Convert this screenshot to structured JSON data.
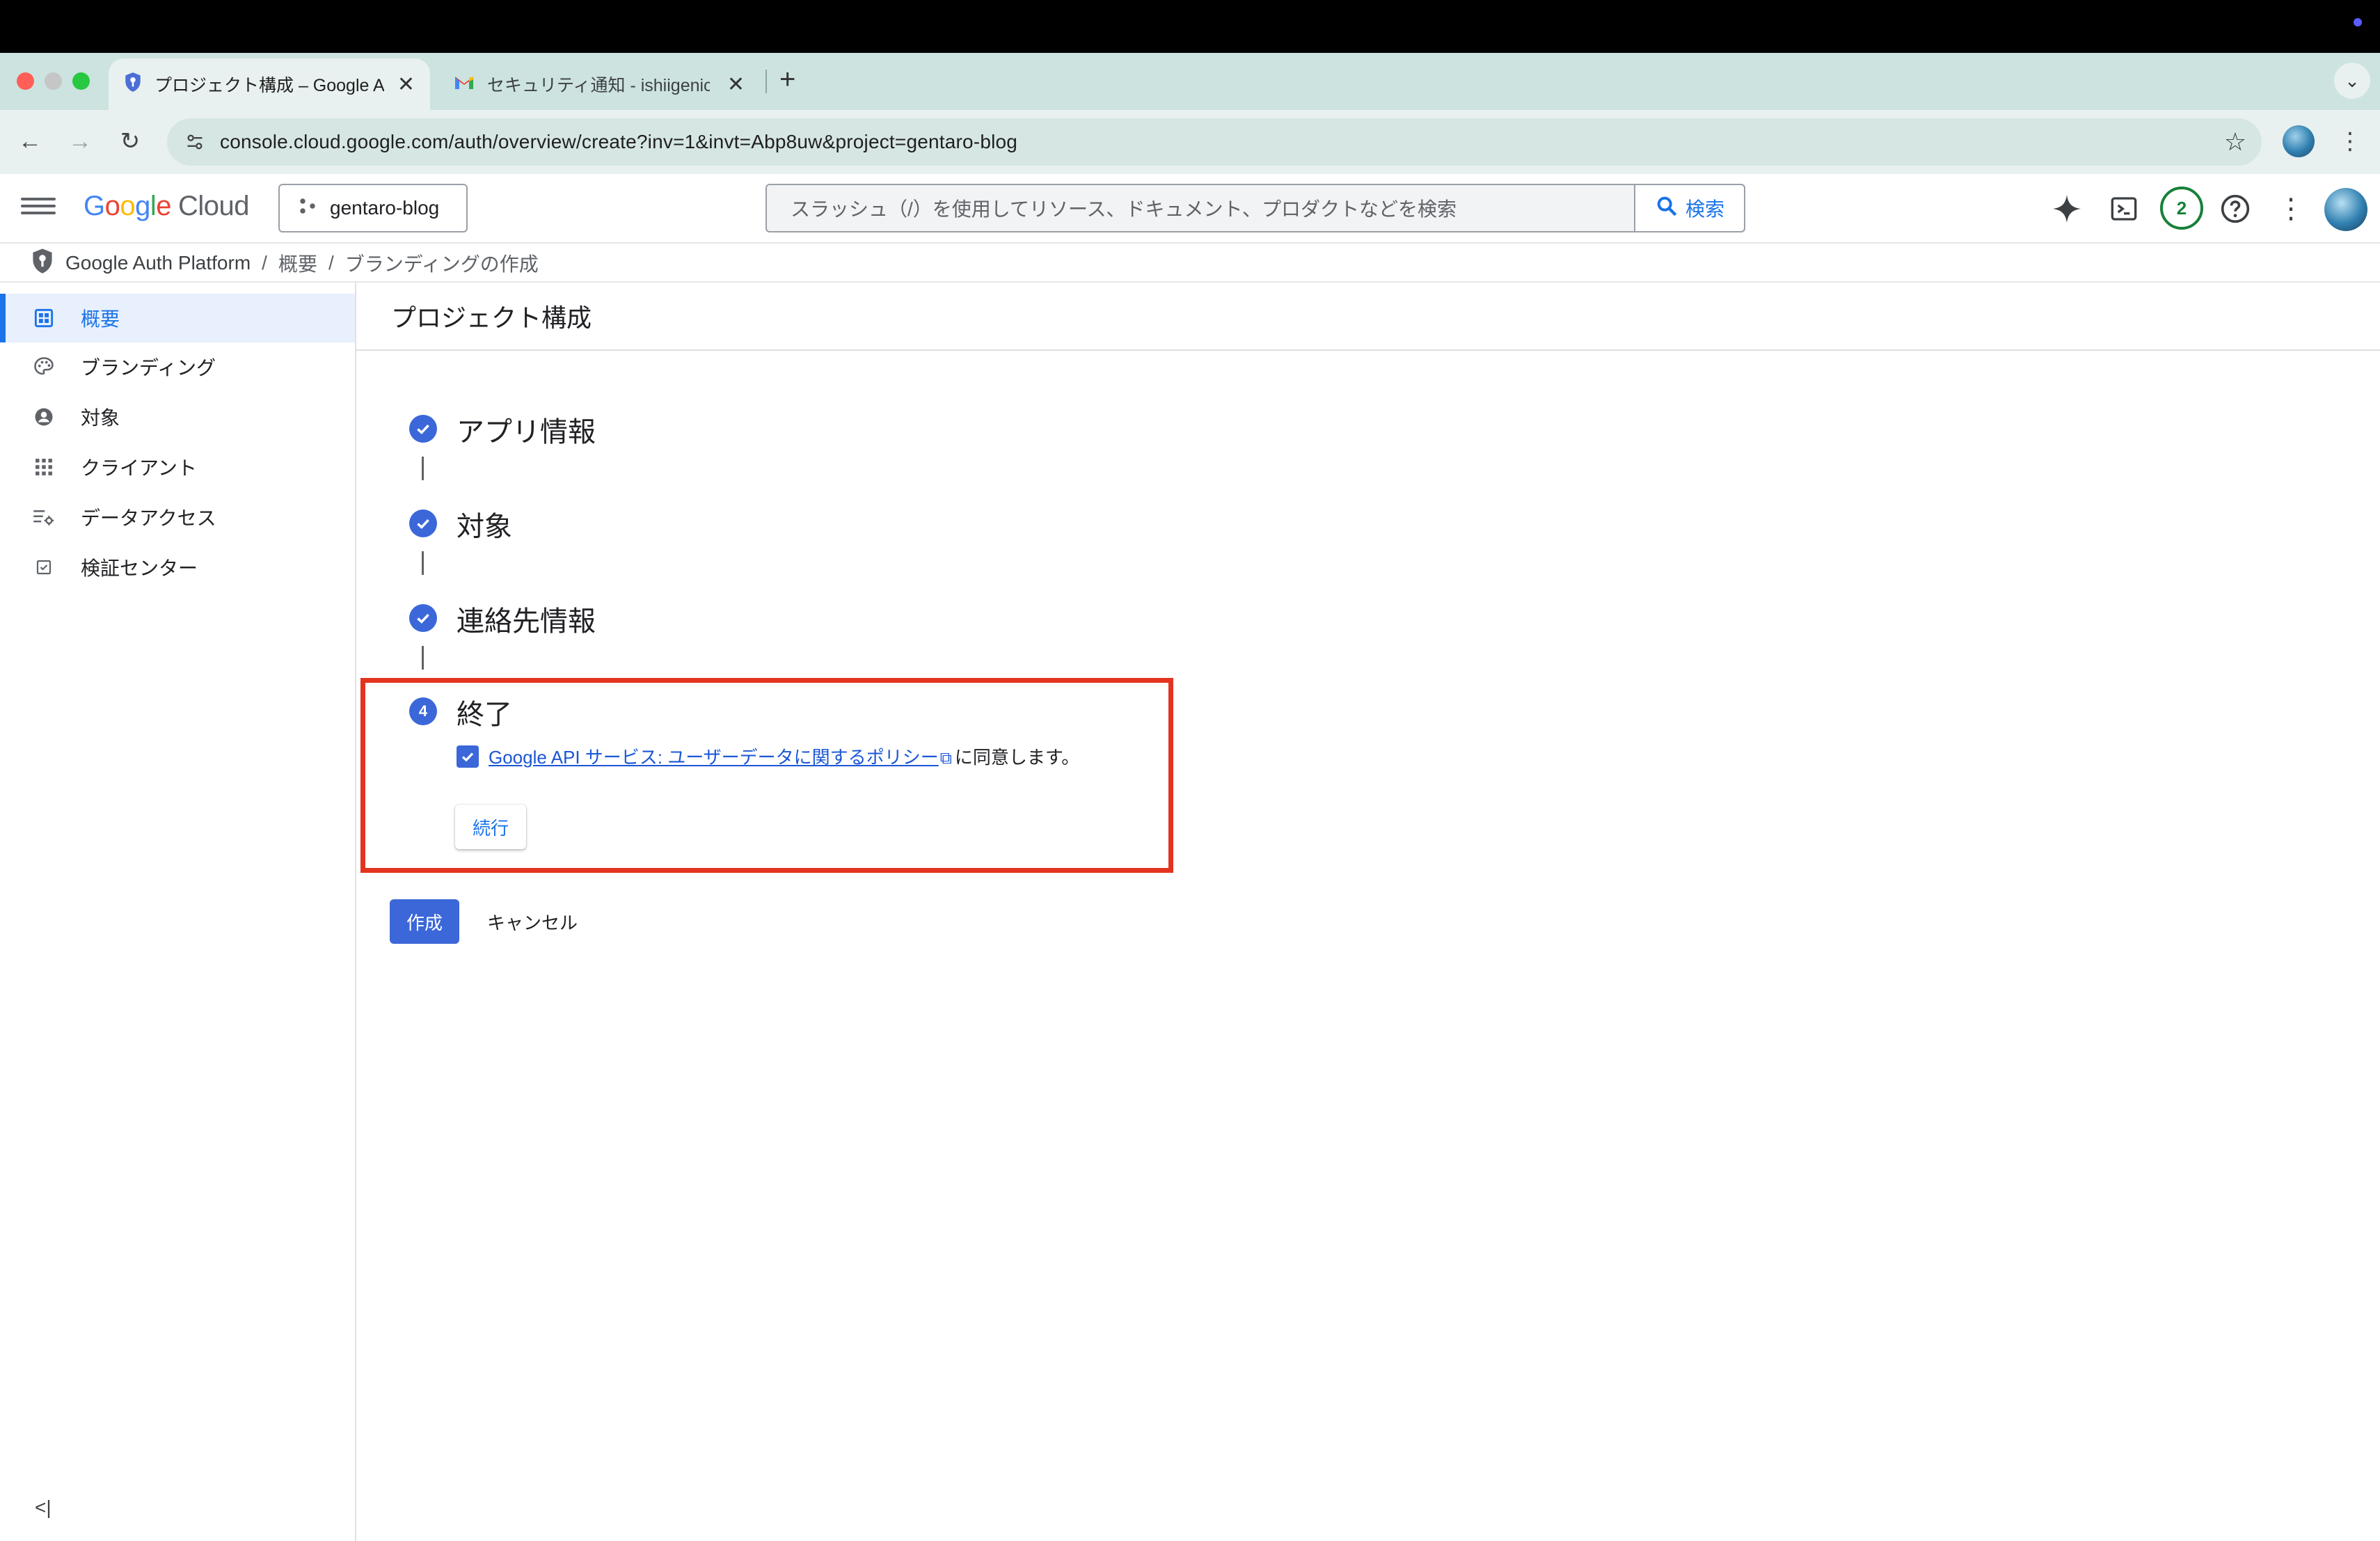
{
  "browser": {
    "tabs": [
      {
        "title": "プロジェクト構成 – Google Auth Platform",
        "icon": "shield-icon"
      },
      {
        "title": "セキュリティ通知 - ishiigenichi",
        "icon": "gmail-icon"
      }
    ],
    "url": "console.cloud.google.com/auth/overview/create?inv=1&invt=Abp8uw&project=gentaro-blog"
  },
  "header": {
    "logo_google": "Google",
    "logo_cloud": "Cloud",
    "project": "gentaro-blog",
    "search_placeholder": "スラッシュ（/）を使用してリソース、ドキュメント、プロダクトなどを検索",
    "search_button": "検索",
    "notification_count": "2"
  },
  "breadcrumb": {
    "root": "Google Auth Platform",
    "items": [
      "概要",
      "ブランディングの作成"
    ],
    "separator": "/"
  },
  "sidebar": {
    "items": [
      {
        "label": "概要",
        "icon": "dashboard-icon",
        "active": true
      },
      {
        "label": "ブランディング",
        "icon": "palette-icon"
      },
      {
        "label": "対象",
        "icon": "account-circle-icon"
      },
      {
        "label": "クライアント",
        "icon": "apps-grid-icon"
      },
      {
        "label": "データアクセス",
        "icon": "data-access-settings-icon"
      },
      {
        "label": "検証センター",
        "icon": "verified-checkbox-icon"
      }
    ]
  },
  "main": {
    "title": "プロジェクト構成",
    "steps": [
      {
        "label": "アプリ情報",
        "state": "done"
      },
      {
        "label": "対象",
        "state": "done"
      },
      {
        "label": "連絡先情報",
        "state": "done"
      },
      {
        "label": "終了",
        "state": "current",
        "number": "4"
      }
    ],
    "consent_link": "Google API サービス: ユーザーデータに関するポリシー",
    "consent_suffix": "に同意します。",
    "consent_checked": true,
    "continue_button": "続行",
    "create_button": "作成",
    "cancel_button": "キャンセル"
  },
  "colors": {
    "accent": "#3b67d8",
    "highlight_box": "#e3341f",
    "link": "#1a56d6"
  }
}
